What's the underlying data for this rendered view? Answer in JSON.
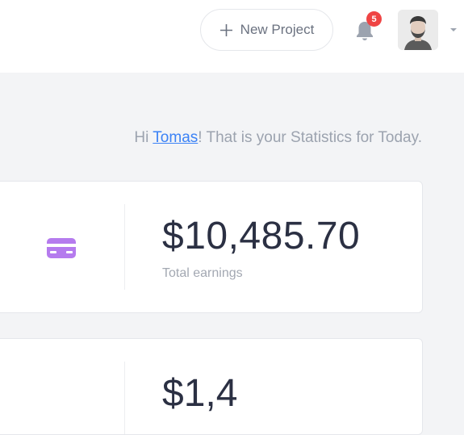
{
  "header": {
    "new_project_label": "New Project",
    "notifications_count": "5",
    "icons": [
      "plus-icon",
      "bell-icon",
      "avatar",
      "chevron-down-icon"
    ]
  },
  "greeting": {
    "prefix": "Hi ",
    "user_name": "Tomas",
    "suffix": "! That is your Statistics for Today."
  },
  "stats": [
    {
      "icon": "credit-card-icon",
      "value": "$10,485.70",
      "label": "Total earnings",
      "icon_color": "#b57bee"
    },
    {
      "value": "$1,4"
    }
  ]
}
